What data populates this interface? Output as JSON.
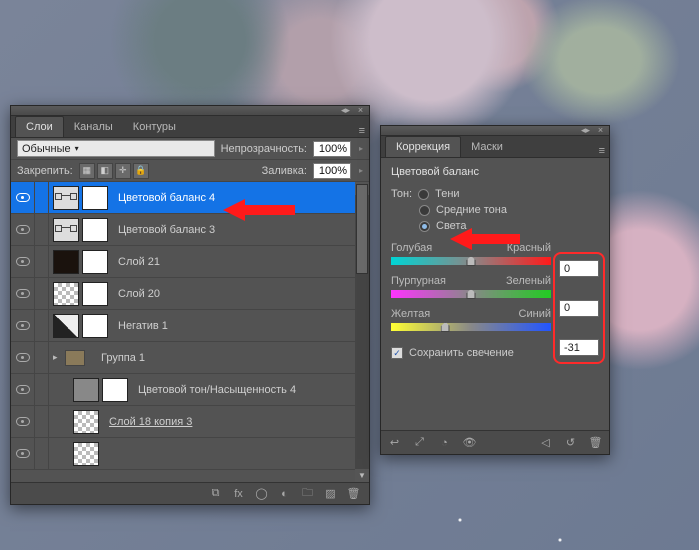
{
  "layers_panel": {
    "tabs": [
      "Слои",
      "Каналы",
      "Контуры"
    ],
    "blend_mode": "Обычные",
    "opacity_label": "Непрозрачность:",
    "opacity_value": "100%",
    "lock_label": "Закрепить:",
    "fill_label": "Заливка:",
    "fill_value": "100%",
    "layers": [
      {
        "name": "Цветовой баланс 4",
        "type": "balance",
        "selected": true
      },
      {
        "name": "Цветовой баланс 3",
        "type": "balance"
      },
      {
        "name": "Слой 21",
        "type": "dark"
      },
      {
        "name": "Слой 20",
        "type": "cb"
      },
      {
        "name": "Негатив 1",
        "type": "neg"
      },
      {
        "name": "Группа 1",
        "type": "group",
        "twisty": true
      },
      {
        "name": "Цветовой тон/Насыщенность 4",
        "type": "hue",
        "indent": 1
      },
      {
        "name": "Слой 18 копия 3",
        "type": "cb",
        "indent": 1,
        "underline": true
      },
      {
        "name": "",
        "type": "cb",
        "indent": 1
      }
    ]
  },
  "adjustments_panel": {
    "tabs": [
      "Коррекция",
      "Маски"
    ],
    "title": "Цветовой баланс",
    "tone_label": "Тон:",
    "tone_options": [
      "Тени",
      "Средние тона",
      "Света"
    ],
    "tone_selected": 2,
    "sliders": [
      {
        "left": "Голубая",
        "right": "Красный",
        "value": 0,
        "pos": 50
      },
      {
        "left": "Пурпурная",
        "right": "Зеленый",
        "value": 0,
        "pos": 50
      },
      {
        "left": "Желтая",
        "right": "Синий",
        "value": -31,
        "pos": 34
      }
    ],
    "preserve_label": "Сохранить свечение",
    "preserve_checked": true
  },
  "icons": {
    "menu": "≡",
    "close": "×",
    "collapse": "◂▸",
    "flyout": "▾",
    "lock_full": "🔒",
    "lock_trans": "▦",
    "lock_img": "◧",
    "lock_pos": "✛",
    "link": "⧉",
    "fx": "fx",
    "mask": "◯",
    "adj": "◐",
    "group": "🗀",
    "new": "▨",
    "trash": "🗑",
    "back": "↩",
    "expand": "⤢",
    "clip": "◔",
    "eye": "👁",
    "prev": "◁",
    "reset": "↺",
    "del": "🗑"
  }
}
